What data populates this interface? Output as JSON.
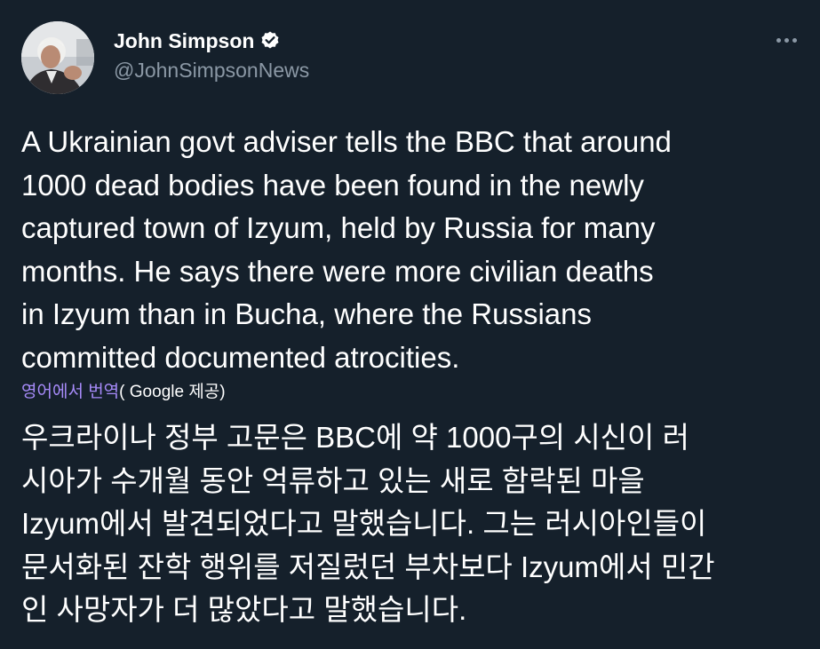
{
  "author": {
    "display_name": "John Simpson",
    "handle": "@JohnSimpsonNews",
    "verified_icon": "verified-badge-icon",
    "avatar": "profile-photo"
  },
  "menu": {
    "more_icon": "more-horizontal-icon"
  },
  "tweet": {
    "text": "A Ukrainian govt adviser tells the BBC that around\n1000 dead bodies have been found in the newly\ncaptured town of Izyum, held by Russia for many\nmonths. He says there were more civilian deaths\nin Izyum than in Bucha, where the Russians\ncommitted documented atrocities."
  },
  "translation": {
    "link_label": "영어에서 번역",
    "provider_label": "( Google 제공)",
    "text": "우크라이나 정부 고문은 BBC에 약 1000구의 시신이 러\n시아가 수개월 동안 억류하고 있는 새로 함락된 마을\nIzyum에서 발견되었다고 말했습니다. 그는 러시아인들이\n문서화된 잔학 행위를 저질렀던 부차보다 Izyum에서 민간\n인 사망자가 더 많았다고 말했습니다."
  },
  "colors": {
    "background": "#15202b",
    "text_primary": "#ffffff",
    "text_secondary": "#8b98a5",
    "translate_link": "#a78bfa"
  }
}
